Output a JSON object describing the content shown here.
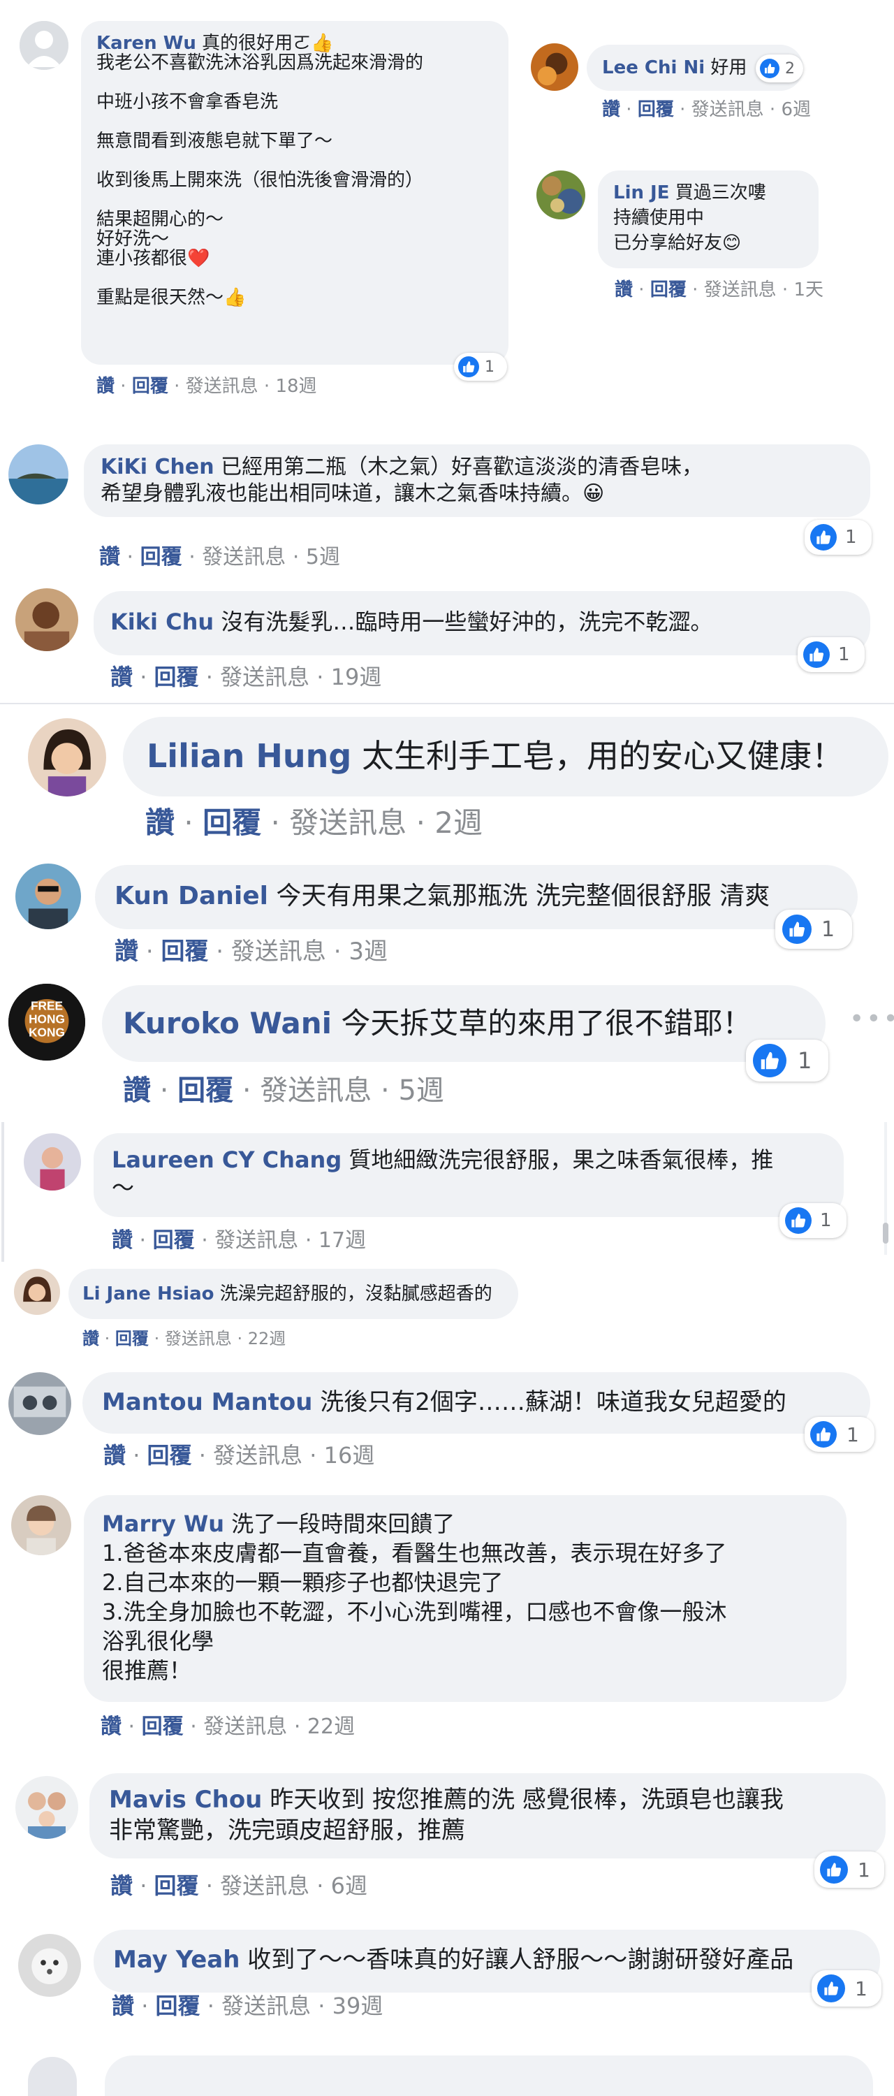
{
  "actions": {
    "like": "讚",
    "reply": "回覆",
    "message": "發送訊息",
    "dot": "·"
  },
  "colors": {
    "link": "#385898",
    "bubble": "#f0f2f5",
    "like_blue": "#1877f2"
  },
  "comments": [
    {
      "name": "Karen Wu",
      "lines": [
        "真的很好用ㄛ👍",
        "我老公不喜歡洗沐浴乳因爲洗起來滑滑的",
        "",
        "中班小孩不會拿香皂洗",
        "",
        "無意間看到液態皂就下單了～",
        "",
        "收到後馬上開來洗（很怕洗後會滑滑的）",
        "",
        "結果超開心的～",
        "好好洗～",
        "連小孩都很❤️",
        "",
        "重點是很天然～👍"
      ],
      "time": "18週",
      "likes": "1"
    },
    {
      "name": "Lee Chi Ni",
      "lines": [
        "好用"
      ],
      "time": "6週",
      "likes": "2"
    },
    {
      "name": "Lin JE",
      "lines": [
        "買過三次嘍",
        "持續使用中",
        "已分享給好友😊"
      ],
      "time": "1天"
    },
    {
      "name": "KiKi Chen",
      "lines": [
        "已經用第二瓶（木之氣）好喜歡這淡淡的清香皂味，",
        "希望身體乳液也能出相同味道，讓木之氣香味持續。😀"
      ],
      "time": "5週",
      "likes": "1"
    },
    {
      "name": "Kiki Chu",
      "lines": [
        "沒有洗髮乳…臨時用一些蠻好沖的，洗完不乾澀。"
      ],
      "time": "19週",
      "likes": "1"
    },
    {
      "name": "Lilian Hung",
      "lines": [
        "太生利手工皂，用的安心又健康！"
      ],
      "time": "2週"
    },
    {
      "name": "Kun Daniel",
      "lines": [
        "今天有用果之氣那瓶洗 洗完整個很舒服 清爽"
      ],
      "time": "3週",
      "likes": "1"
    },
    {
      "name": "Kuroko Wani",
      "lines": [
        "今天拆艾草的來用了很不錯耶！"
      ],
      "time": "5週",
      "likes": "1",
      "avatar_text": [
        "FREE",
        "HONG",
        "KONG"
      ]
    },
    {
      "name": "Laureen CY Chang",
      "lines": [
        "質地細緻洗完很舒服，果之味香氣很棒，推",
        "～"
      ],
      "time": "17週",
      "likes": "1"
    },
    {
      "name": "Li Jane Hsiao",
      "lines": [
        "洗澡完超舒服的，沒黏膩感超香的"
      ],
      "time": "22週"
    },
    {
      "name": "Mantou Mantou",
      "lines": [
        "洗後只有2個字……蘇湖！味道我女兒超愛的"
      ],
      "time": "16週",
      "likes": "1"
    },
    {
      "name": "Marry Wu",
      "lines": [
        "洗了一段時間來回饋了",
        "1.爸爸本來皮膚都一直會養，看醫生也無改善，表示現在好多了",
        "2.自己本來的一顆一顆疹子也都快退完了",
        "3.洗全身加臉也不乾澀，不小心洗到嘴裡，口感也不會像一般沐",
        "浴乳很化學",
        "很推薦！"
      ],
      "time": "22週"
    },
    {
      "name": "Mavis Chou",
      "lines": [
        "昨天收到 按您推薦的洗 感覺很棒，洗頭皂也讓我",
        "非常驚艷，洗完頭皮超舒服，推薦"
      ],
      "time": "6週",
      "likes": "1"
    },
    {
      "name": "May Yeah",
      "lines": [
        "收到了～～香味真的好讓人舒服～～謝謝研發好產品"
      ],
      "time": "39週",
      "likes": "1"
    }
  ]
}
